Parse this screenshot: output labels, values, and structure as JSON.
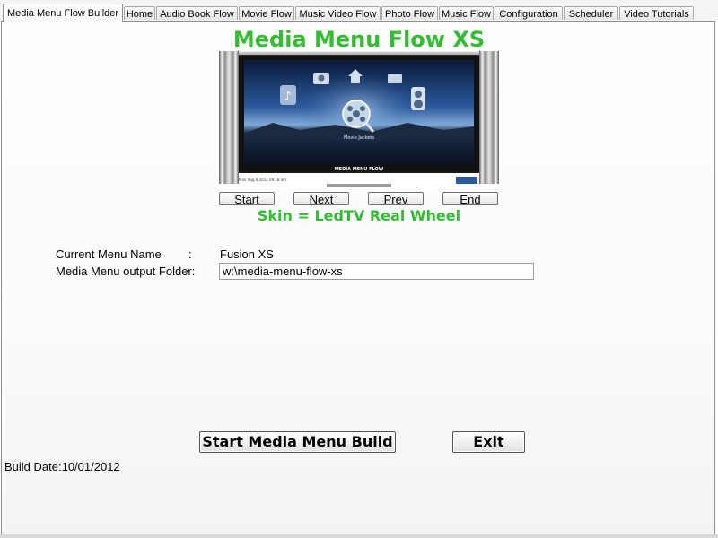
{
  "tabs": [
    {
      "label": "Media Menu Flow Builder",
      "active": true
    },
    {
      "label": "Home"
    },
    {
      "label": "Audio Book Flow"
    },
    {
      "label": "Movie Flow"
    },
    {
      "label": "Music Video Flow"
    },
    {
      "label": "Photo Flow"
    },
    {
      "label": "Music Flow"
    },
    {
      "label": "Configuration"
    },
    {
      "label": "Scheduler"
    },
    {
      "label": "Video Tutorials"
    }
  ],
  "main": {
    "title": "Media Menu Flow XS",
    "preview": {
      "brand": "MEDIA MENU FLOW",
      "caption": "Movie Jackets",
      "datetime": "Mon Aug 6 2012 09:18 am"
    },
    "nav": {
      "start": "Start",
      "next": "Next",
      "prev": "Prev",
      "end": "End"
    },
    "skin_text": "Skin = LedTV Real Wheel",
    "current_menu_label": "Current Menu Name",
    "current_menu_colon": ":",
    "current_menu_value": "Fusion XS",
    "output_folder_label": "Media Menu output Folder:",
    "output_folder_value": "w:\\media-menu-flow-xs",
    "start_build_label": "Start Media Menu Build",
    "exit_label": "Exit",
    "build_date": "Build Date:10/01/2012"
  },
  "colors": {
    "accent_green": "#2fbf2f"
  }
}
